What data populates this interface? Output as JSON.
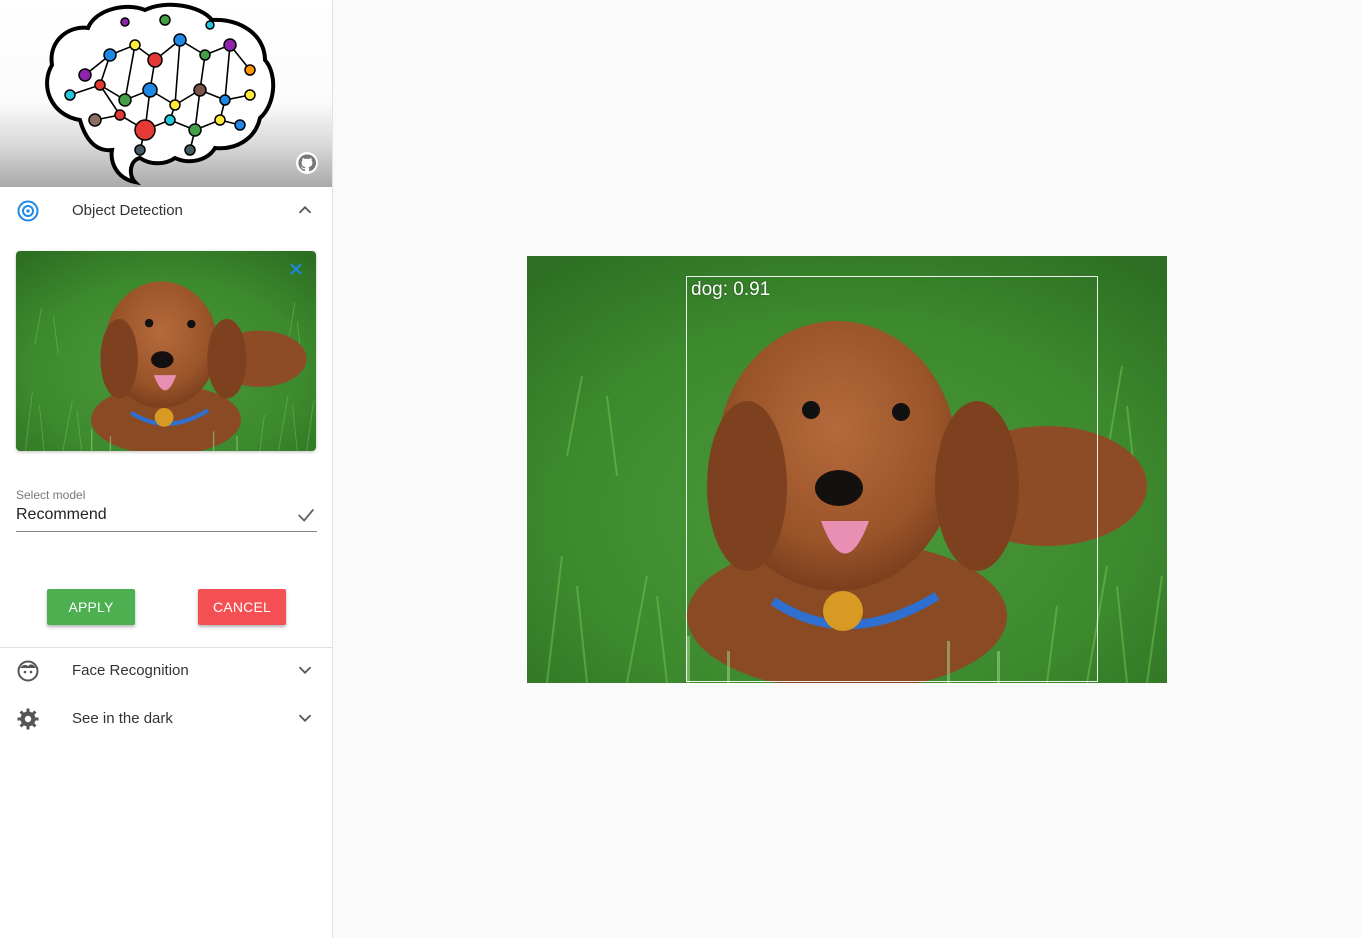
{
  "app": {
    "github_link": "github-icon"
  },
  "panels": {
    "object_detection": {
      "label": "Object Detection",
      "icon": "target-icon",
      "expanded": true,
      "select_model": {
        "label": "Select model",
        "value": "Recommend"
      },
      "apply_label": "APPLY",
      "cancel_label": "CANCEL"
    },
    "face_recognition": {
      "label": "Face Recognition",
      "icon": "face-icon",
      "expanded": false
    },
    "see_in_dark": {
      "label": "See in the dark",
      "icon": "gear-icon",
      "expanded": false
    }
  },
  "result": {
    "detection_label": "dog: 0.91"
  },
  "colors": {
    "accent": "#1e88e5",
    "apply": "#4caf50",
    "cancel": "#f44f52"
  }
}
